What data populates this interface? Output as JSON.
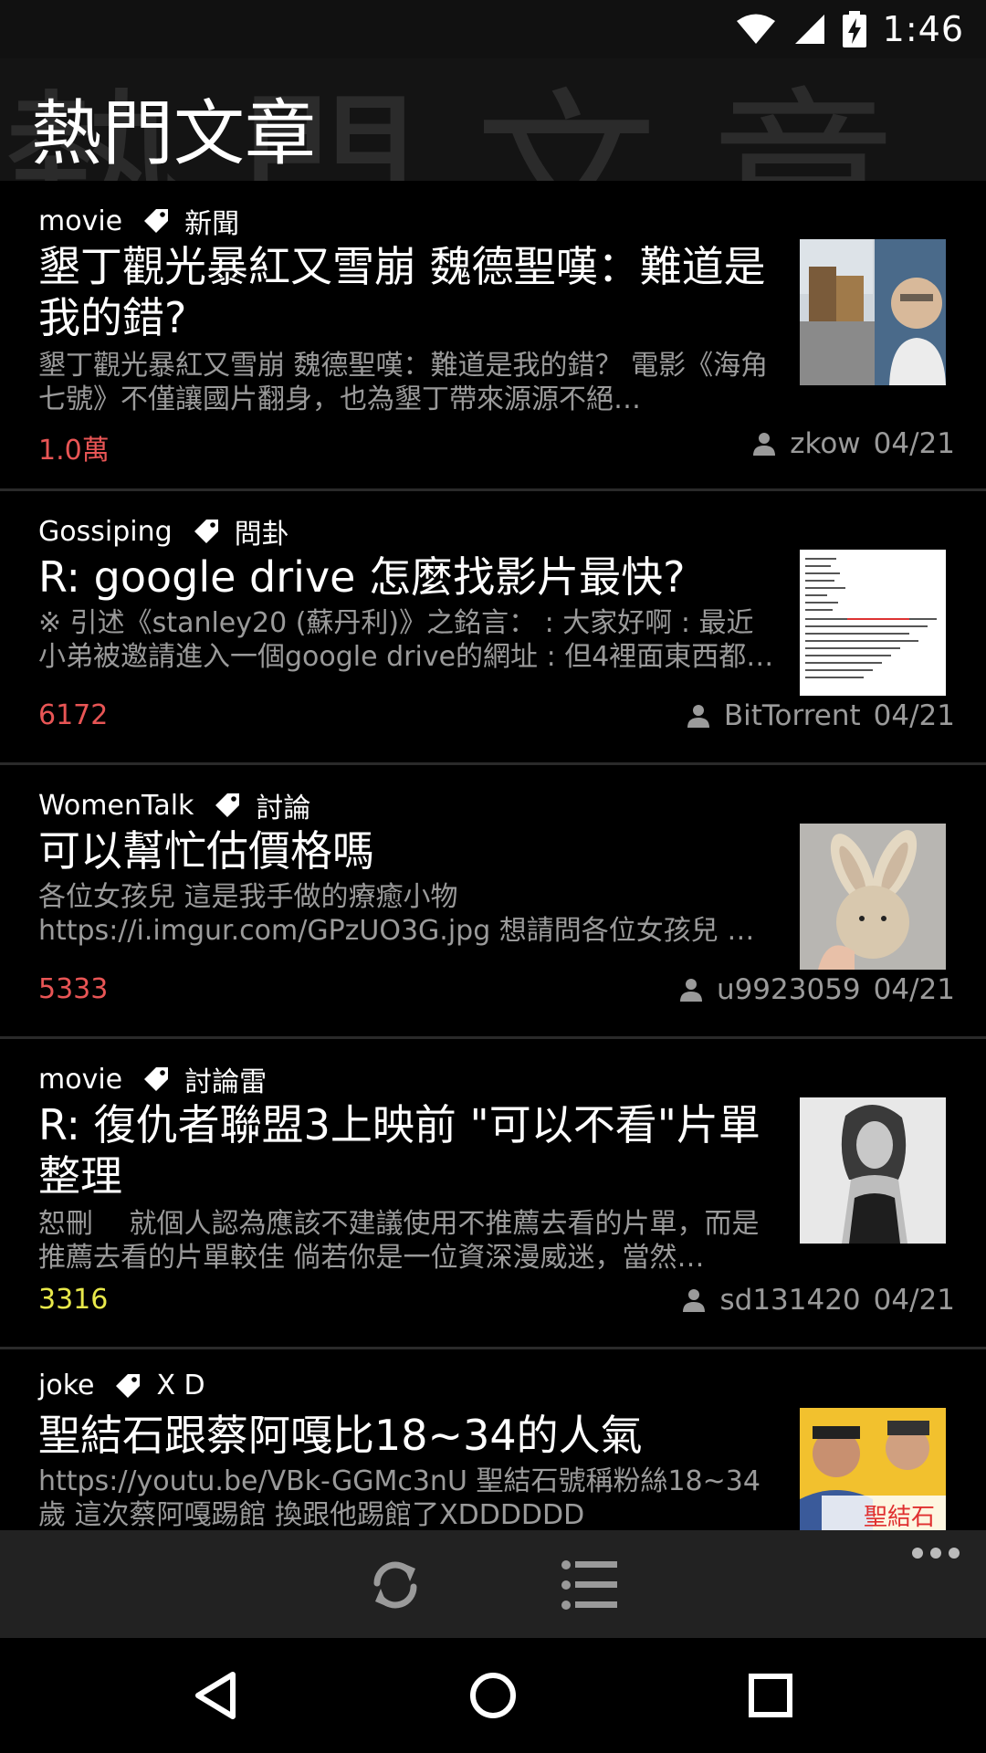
{
  "status_bar": {
    "time": "1:46"
  },
  "header": {
    "title": "熱門文章",
    "background_text": "熱門文章"
  },
  "posts": [
    {
      "board": "movie",
      "category": "新聞",
      "title": "墾丁觀光暴紅又雪崩 魏德聖嘆：難道是我的錯?",
      "excerpt": "墾丁觀光暴紅又雪崩 魏德聖嘆：難道是我的錯？ 電影《海角七號》不僅讓國片翻身，也為墾丁帶來源源不絕…",
      "count": "1.0萬",
      "count_color": "#e85555",
      "author": "zkow",
      "date": "04/21",
      "thumb": "street-photo"
    },
    {
      "board": "Gossiping",
      "category": "問卦",
      "title": "R: google drive 怎麼找影片最快?",
      "excerpt": "※ 引述《stanley20 (蘇丹利)》之銘言： : 大家好啊 : 最近小弟被邀請進入一個google drive的網址 : 但4裡面東西都…",
      "count": "6172",
      "count_color": "#e85555",
      "author": "BitTorrent",
      "date": "04/21",
      "thumb": "document-screenshot"
    },
    {
      "board": "WomenTalk",
      "category": "討論",
      "title": "可以幫忙估價格嗎",
      "excerpt": "各位女孩兒 這是我手做的療癒小物 https://i.imgur.com/GPzUO3G.jpg 想請問各位女孩兒 會願意花費多少錢買這…",
      "count": "5333",
      "count_color": "#e85555",
      "author": "u9923059",
      "date": "04/21",
      "thumb": "bunny-plush"
    },
    {
      "board": "movie",
      "category": "討論雷",
      "title": "R: 復仇者聯盟3上映前 \"可以不看\"片單整理",
      "excerpt": "恕刪　 就個人認為應該不建議使用不推薦去看的片單，而是推薦去看的片單較佳 倘若你是一位資深漫威迷，當然…",
      "count": "3316",
      "count_color": "#e8e84a",
      "author": "sd131420",
      "date": "04/21",
      "thumb": "portrait-bw"
    },
    {
      "board": "joke",
      "category": "X D",
      "title": "聖結石跟蔡阿嘎比18~34的人氣",
      "excerpt": "https://youtu.be/VBk-GGMc3nU 聖結石號稱粉絲18~34歲 這次蔡阿嘎踢館 換跟他踢館了XDDDDDD",
      "count": "",
      "count_color": "#e85555",
      "author": "",
      "date": "",
      "thumb": "video-thumbnail"
    }
  ],
  "thumb_texts": {
    "video_badge": "聖結石"
  },
  "toolbar": {
    "icons": [
      "refresh-icon",
      "list-icon",
      "more-icon"
    ]
  },
  "navbar": {
    "icons": [
      "back-icon",
      "home-icon",
      "recents-icon"
    ]
  }
}
